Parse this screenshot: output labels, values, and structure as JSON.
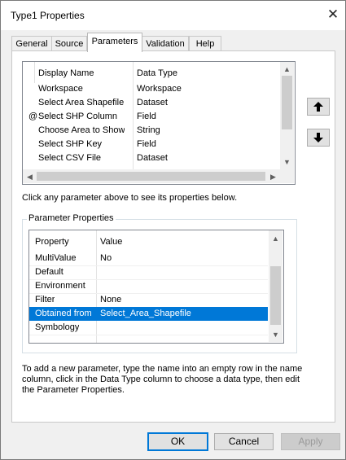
{
  "window": {
    "title": "Type1 Properties",
    "close_glyph": "✕"
  },
  "tabs": [
    {
      "label": "General"
    },
    {
      "label": "Source"
    },
    {
      "label": "Parameters",
      "active": true
    },
    {
      "label": "Validation"
    },
    {
      "label": "Help"
    }
  ],
  "params_grid": {
    "headers": {
      "name": "Display Name",
      "type": "Data Type"
    },
    "rows": [
      {
        "marker": "",
        "name": "Workspace",
        "type": "Workspace"
      },
      {
        "marker": "",
        "name": "Select Area Shapefile",
        "type": "Dataset"
      },
      {
        "marker": "@",
        "name": "Select SHP Column",
        "type": "Field"
      },
      {
        "marker": "",
        "name": "Choose Area to Show",
        "type": "String"
      },
      {
        "marker": "",
        "name": "Select SHP Key",
        "type": "Field"
      },
      {
        "marker": "",
        "name": "Select CSV File",
        "type": "Dataset"
      }
    ]
  },
  "move_up_icon": "thick-up-arrow-icon",
  "move_down_icon": "thick-down-arrow-icon",
  "hint_text": "Click any parameter above to see its properties below.",
  "param_props": {
    "group_label": "Parameter Properties",
    "headers": {
      "property": "Property",
      "value": "Value"
    },
    "rows": [
      {
        "property": "MultiValue",
        "value": "No",
        "selected": false
      },
      {
        "property": "Default",
        "value": "",
        "selected": false
      },
      {
        "property": "Environment",
        "value": "",
        "selected": false
      },
      {
        "property": "Filter",
        "value": "None",
        "selected": false
      },
      {
        "property": "Obtained from",
        "value": "Select_Area_Shapefile",
        "selected": true
      },
      {
        "property": "Symbology",
        "value": "",
        "selected": false
      }
    ]
  },
  "help_text": "To add a new parameter, type the name into an empty row in the name column, click in the Data Type column to choose a data type, then edit the Parameter Properties.",
  "buttons": {
    "ok": "OK",
    "cancel": "Cancel",
    "apply": "Apply"
  },
  "colors": {
    "selection": "#0078d7",
    "selection_text": "#ffffff",
    "disabled_text": "#9a9a9a"
  }
}
